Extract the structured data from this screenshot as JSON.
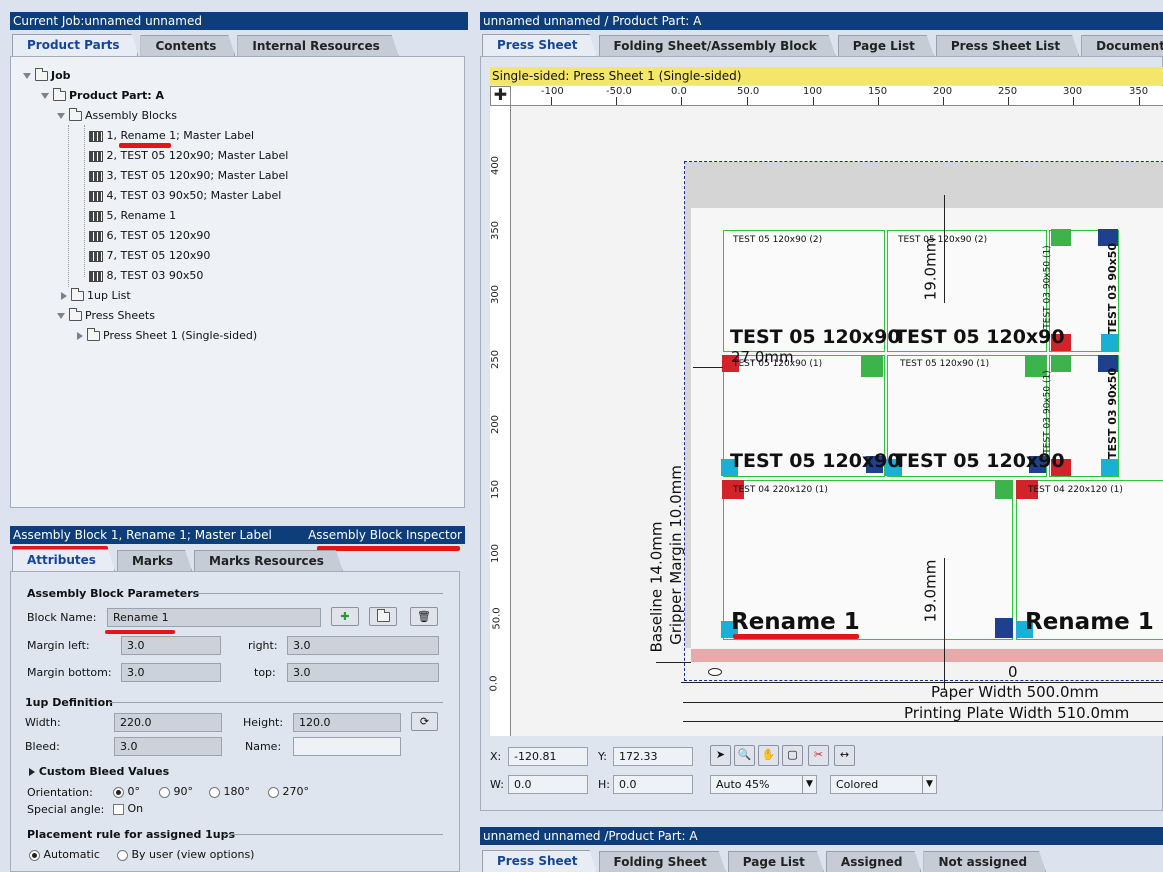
{
  "left_top": {
    "title": "Current Job:unnamed unnamed",
    "tabs": [
      "Product Parts",
      "Contents",
      "Internal Resources"
    ],
    "tree": {
      "job": "Job",
      "product_part": "Product Part: A",
      "assembly_blocks": "Assembly Blocks",
      "blocks": [
        {
          "num": "1, ",
          "name": "Rename 1",
          "rest": "; Master Label"
        },
        {
          "num": "2, ",
          "name": "TEST 05 120x90",
          "rest": "; Master Label"
        },
        {
          "num": "3, ",
          "name": "TEST 05 120x90",
          "rest": "; Master Label"
        },
        {
          "num": "4, ",
          "name": "TEST 03 90x50",
          "rest": "; Master Label"
        },
        {
          "num": "5, ",
          "name": "Rename 1",
          "rest": ""
        },
        {
          "num": "6, ",
          "name": "TEST 05 120x90",
          "rest": ""
        },
        {
          "num": "7, ",
          "name": "TEST 05 120x90",
          "rest": ""
        },
        {
          "num": "8, ",
          "name": "TEST 03 90x50",
          "rest": ""
        }
      ],
      "oneup_list": "1up List",
      "press_sheets": "Press Sheets",
      "press_sheet_1": "Press Sheet 1 (Single-sided)"
    }
  },
  "inspector": {
    "title": "Assembly Block 1, Rename 1; Master Label",
    "right_title": "Assembly Block Inspector",
    "tabs": [
      "Attributes",
      "Marks",
      "Marks Resources"
    ],
    "params_heading": "Assembly Block Parameters",
    "block_name_label": "Block Name:",
    "block_name": "Rename 1",
    "margin_left_label": "Margin left:",
    "margin_left": "3.0",
    "right_label": "right:",
    "margin_right": "3.0",
    "margin_bottom_label": "Margin bottom:",
    "margin_bottom": "3.0",
    "top_label": "top:",
    "margin_top": "3.0",
    "oneup_heading": "1up Definition",
    "width_label": "Width:",
    "width": "220.0",
    "height_label": "Height:",
    "height": "120.0",
    "bleed_label": "Bleed:",
    "bleed": "3.0",
    "name_label": "Name:",
    "name": "",
    "custom_bleed": "Custom Bleed Values",
    "orientation_label": "Orientation:",
    "orientations": [
      "0°",
      "90°",
      "180°",
      "270°"
    ],
    "special_angle_label": "Special angle:",
    "special_angle_on": "On",
    "placement_heading": "Placement rule for assigned 1ups",
    "placement_auto": "Automatic",
    "placement_user": "By user (view options)"
  },
  "editor": {
    "title": "unnamed unnamed  / Product Part: A",
    "tabs": [
      "Press Sheet",
      "Folding Sheet/Assembly Block",
      "Page List",
      "Press Sheet List",
      "Document"
    ],
    "info_bar": "Single-sided:  Press Sheet 1 (Single-sided)",
    "h_ticks": [
      "-100",
      "-50.0",
      "0.0",
      "50.0",
      "100",
      "150",
      "200",
      "250",
      "300",
      "350"
    ],
    "v_ticks": [
      "400",
      "350",
      "300",
      "250",
      "200",
      "150",
      "100",
      "50.0",
      "0.0"
    ],
    "sheet": {
      "small_labels": [
        "TEST 05 120x90 (2)",
        "TEST 05 120x90 (2)",
        "TEST 05 120x90 (1)",
        "TEST 05 120x90 (1)",
        "TEST 04 220x120 (1)",
        "TEST 04 220x120 (1)"
      ],
      "big_labels": [
        "TEST 05 120x90",
        "TEST 05 120x90",
        "TEST 05 120x90",
        "TEST 05 120x90"
      ],
      "rotated_small": [
        "TEST 03 90x50 (1)",
        "TEST 03 90x50 (1)"
      ],
      "rotated_big": [
        "TEST 03 90x50",
        "TEST 03 90x50"
      ],
      "rename_labels": [
        "Rename 1",
        "Rename 1"
      ],
      "dim_19_top": "19.0mm",
      "dim_27": "27.0mm",
      "dim_19_bottom": "19.0mm",
      "baseline": "Baseline 14.0mm",
      "gripper": "Gripper Margin 10.0mm",
      "zero": "0",
      "paper_width": "Paper Width 500.0mm",
      "plate_width": "Printing Plate Width 510.0mm"
    },
    "x_label": "X:",
    "x_value": "-120.81",
    "y_label": "Y:",
    "y_value": "172.33",
    "w_label": "W:",
    "w_value": "0.0",
    "h_label": "H:",
    "h_value": "0.0",
    "zoom": "Auto 45%",
    "color_mode": "Colored"
  },
  "bottom_right": {
    "title": "unnamed unnamed /Product Part: A",
    "tabs": [
      "Press Sheet",
      "Folding Sheet",
      "Page List",
      "Assigned",
      "Not assigned"
    ]
  }
}
